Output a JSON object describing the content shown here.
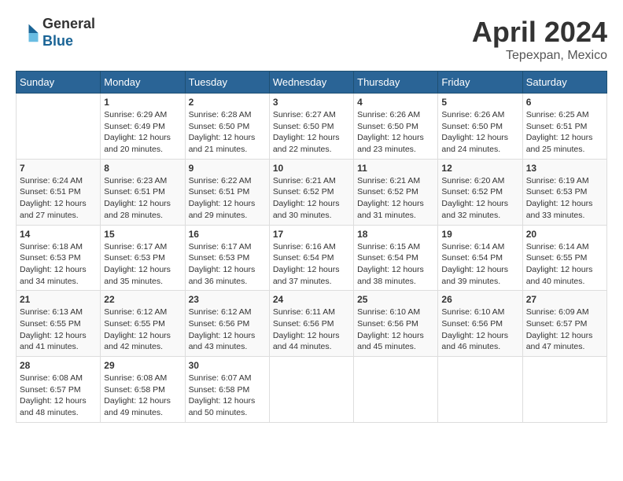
{
  "header": {
    "logo_line1": "General",
    "logo_line2": "Blue",
    "month": "April 2024",
    "location": "Tepexpan, Mexico"
  },
  "days_of_week": [
    "Sunday",
    "Monday",
    "Tuesday",
    "Wednesday",
    "Thursday",
    "Friday",
    "Saturday"
  ],
  "weeks": [
    [
      {
        "day": "",
        "content": ""
      },
      {
        "day": "1",
        "content": "Sunrise: 6:29 AM\nSunset: 6:49 PM\nDaylight: 12 hours\nand 20 minutes."
      },
      {
        "day": "2",
        "content": "Sunrise: 6:28 AM\nSunset: 6:50 PM\nDaylight: 12 hours\nand 21 minutes."
      },
      {
        "day": "3",
        "content": "Sunrise: 6:27 AM\nSunset: 6:50 PM\nDaylight: 12 hours\nand 22 minutes."
      },
      {
        "day": "4",
        "content": "Sunrise: 6:26 AM\nSunset: 6:50 PM\nDaylight: 12 hours\nand 23 minutes."
      },
      {
        "day": "5",
        "content": "Sunrise: 6:26 AM\nSunset: 6:50 PM\nDaylight: 12 hours\nand 24 minutes."
      },
      {
        "day": "6",
        "content": "Sunrise: 6:25 AM\nSunset: 6:51 PM\nDaylight: 12 hours\nand 25 minutes."
      }
    ],
    [
      {
        "day": "7",
        "content": "Sunrise: 6:24 AM\nSunset: 6:51 PM\nDaylight: 12 hours\nand 27 minutes."
      },
      {
        "day": "8",
        "content": "Sunrise: 6:23 AM\nSunset: 6:51 PM\nDaylight: 12 hours\nand 28 minutes."
      },
      {
        "day": "9",
        "content": "Sunrise: 6:22 AM\nSunset: 6:51 PM\nDaylight: 12 hours\nand 29 minutes."
      },
      {
        "day": "10",
        "content": "Sunrise: 6:21 AM\nSunset: 6:52 PM\nDaylight: 12 hours\nand 30 minutes."
      },
      {
        "day": "11",
        "content": "Sunrise: 6:21 AM\nSunset: 6:52 PM\nDaylight: 12 hours\nand 31 minutes."
      },
      {
        "day": "12",
        "content": "Sunrise: 6:20 AM\nSunset: 6:52 PM\nDaylight: 12 hours\nand 32 minutes."
      },
      {
        "day": "13",
        "content": "Sunrise: 6:19 AM\nSunset: 6:53 PM\nDaylight: 12 hours\nand 33 minutes."
      }
    ],
    [
      {
        "day": "14",
        "content": "Sunrise: 6:18 AM\nSunset: 6:53 PM\nDaylight: 12 hours\nand 34 minutes."
      },
      {
        "day": "15",
        "content": "Sunrise: 6:17 AM\nSunset: 6:53 PM\nDaylight: 12 hours\nand 35 minutes."
      },
      {
        "day": "16",
        "content": "Sunrise: 6:17 AM\nSunset: 6:53 PM\nDaylight: 12 hours\nand 36 minutes."
      },
      {
        "day": "17",
        "content": "Sunrise: 6:16 AM\nSunset: 6:54 PM\nDaylight: 12 hours\nand 37 minutes."
      },
      {
        "day": "18",
        "content": "Sunrise: 6:15 AM\nSunset: 6:54 PM\nDaylight: 12 hours\nand 38 minutes."
      },
      {
        "day": "19",
        "content": "Sunrise: 6:14 AM\nSunset: 6:54 PM\nDaylight: 12 hours\nand 39 minutes."
      },
      {
        "day": "20",
        "content": "Sunrise: 6:14 AM\nSunset: 6:55 PM\nDaylight: 12 hours\nand 40 minutes."
      }
    ],
    [
      {
        "day": "21",
        "content": "Sunrise: 6:13 AM\nSunset: 6:55 PM\nDaylight: 12 hours\nand 41 minutes."
      },
      {
        "day": "22",
        "content": "Sunrise: 6:12 AM\nSunset: 6:55 PM\nDaylight: 12 hours\nand 42 minutes."
      },
      {
        "day": "23",
        "content": "Sunrise: 6:12 AM\nSunset: 6:56 PM\nDaylight: 12 hours\nand 43 minutes."
      },
      {
        "day": "24",
        "content": "Sunrise: 6:11 AM\nSunset: 6:56 PM\nDaylight: 12 hours\nand 44 minutes."
      },
      {
        "day": "25",
        "content": "Sunrise: 6:10 AM\nSunset: 6:56 PM\nDaylight: 12 hours\nand 45 minutes."
      },
      {
        "day": "26",
        "content": "Sunrise: 6:10 AM\nSunset: 6:56 PM\nDaylight: 12 hours\nand 46 minutes."
      },
      {
        "day": "27",
        "content": "Sunrise: 6:09 AM\nSunset: 6:57 PM\nDaylight: 12 hours\nand 47 minutes."
      }
    ],
    [
      {
        "day": "28",
        "content": "Sunrise: 6:08 AM\nSunset: 6:57 PM\nDaylight: 12 hours\nand 48 minutes."
      },
      {
        "day": "29",
        "content": "Sunrise: 6:08 AM\nSunset: 6:58 PM\nDaylight: 12 hours\nand 49 minutes."
      },
      {
        "day": "30",
        "content": "Sunrise: 6:07 AM\nSunset: 6:58 PM\nDaylight: 12 hours\nand 50 minutes."
      },
      {
        "day": "",
        "content": ""
      },
      {
        "day": "",
        "content": ""
      },
      {
        "day": "",
        "content": ""
      },
      {
        "day": "",
        "content": ""
      }
    ]
  ]
}
